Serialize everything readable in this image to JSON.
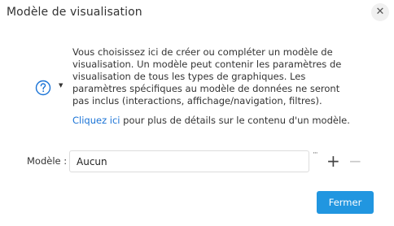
{
  "dialog": {
    "title": "Modèle de visualisation",
    "close_icon_glyph": "✕"
  },
  "info": {
    "icon": "question-circle-icon",
    "icon_color": "#1a73d6",
    "caret_glyph": "▼",
    "description": "Vous choisissez ici de créer ou compléter un modèle de visualisation. Un modèle peut contenir les paramètres de visualisation de tous les types de graphiques. Les paramètres spécifiques au modèle de données ne seront pas inclus (interactions, affichage/navigation, filtres).",
    "link_text": "Cliquez ici",
    "link_suffix": " pour plus de détails sur le contenu d'un modèle."
  },
  "model": {
    "label": "Modèle :",
    "value": "Aucun",
    "ellipsis_glyph": "···",
    "add_glyph": "+",
    "remove_glyph": "−"
  },
  "footer": {
    "close_label": "Fermer",
    "accent_color": "#2196e0"
  }
}
